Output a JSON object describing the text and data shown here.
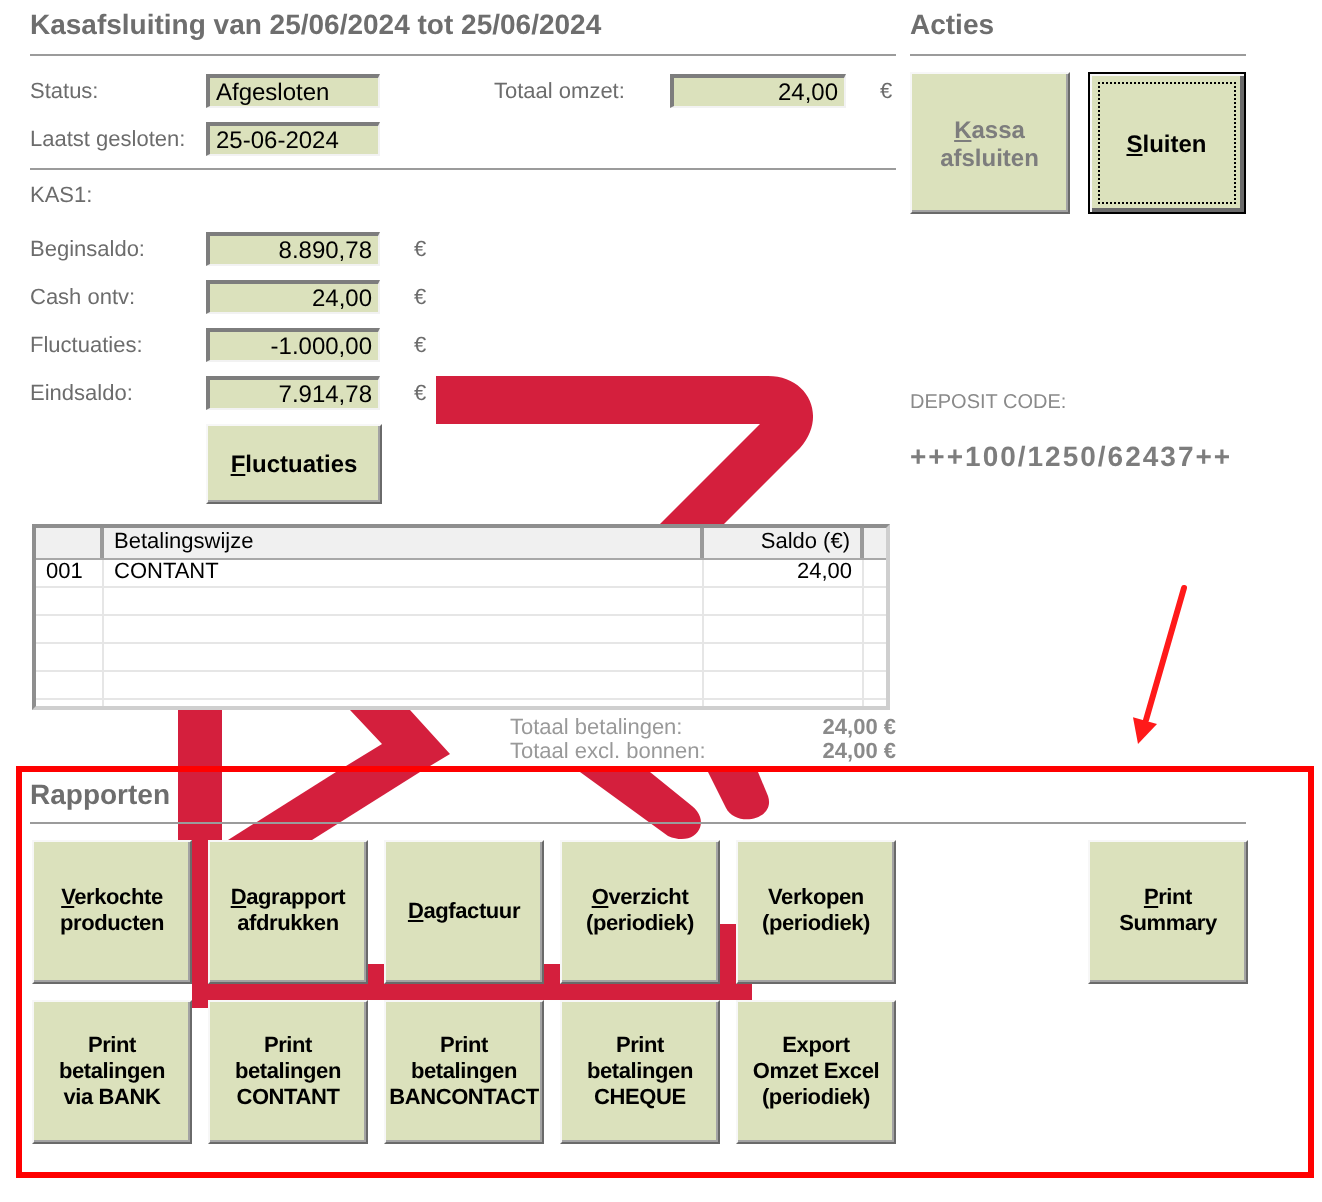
{
  "header": {
    "title": "Kasafsluiting van 25/06/2024 tot 25/06/2024"
  },
  "status": {
    "fields": [
      {
        "label": "Status:",
        "value": "Afgesloten"
      },
      {
        "label": "Laatst gesloten:",
        "value": "25-06-2024"
      }
    ],
    "turnover": {
      "label": "Totaal omzet:",
      "value": "24,00",
      "currency": "€"
    }
  },
  "register": {
    "title": "KAS1:",
    "fields": [
      {
        "label": "Beginsaldo:",
        "value": "8.890,78",
        "currency": "€"
      },
      {
        "label": "Cash ontv:",
        "value": "24,00",
        "currency": "€"
      },
      {
        "label": "Fluctuaties:",
        "value": "-1.000,00",
        "currency": "€"
      },
      {
        "label": "Eindsaldo:",
        "value": "7.914,78",
        "currency": "€"
      }
    ],
    "button": {
      "label": "Fluctuaties",
      "shortcut_underlined": true
    }
  },
  "table": {
    "columns": [
      {
        "label": "Betalingswijze"
      },
      {
        "label": "Saldo (€)"
      }
    ],
    "rows": [
      {
        "number": "001",
        "cells": [
          "CONTANT",
          "24,00"
        ]
      }
    ]
  },
  "totals": [
    {
      "label": "Totaal betalingen:",
      "value": "24,00 €"
    },
    {
      "label": "Totaal excl. bonnen:",
      "value": "24,00 €"
    }
  ],
  "actions": {
    "title": "Acties",
    "buttons": [
      {
        "label": "Kassa\nafsluiten",
        "shortcut_underlined": true,
        "disabled": true,
        "focused": false
      },
      {
        "label": "Sluiten",
        "shortcut_underlined": true,
        "disabled": false,
        "focused": true
      }
    ]
  },
  "deposit": {
    "label": "DEPOSIT CODE:",
    "code": "+++100/1250/62437++"
  },
  "reports": {
    "title": "Rapporten",
    "buttons": [
      {
        "label": "Verkochte\nproducten",
        "shortcut_underlined": true
      },
      {
        "label": "Dagrapport\nafdrukken",
        "shortcut_underlined": true
      },
      {
        "label": "Dagfactuur",
        "shortcut_underlined": true
      },
      {
        "label": "Overzicht\n(periodiek)",
        "shortcut_underlined": true
      },
      {
        "label": "Verkopen\n(periodiek)",
        "shortcut_underlined": false
      },
      {
        "label": "Print\nbetalingen\nvia BANK",
        "shortcut_underlined": false
      },
      {
        "label": "Print\nbetalingen\nCONTANT",
        "shortcut_underlined": false
      },
      {
        "label": "Print\nbetalingen\nBANCONTACT",
        "shortcut_underlined": false
      },
      {
        "label": "Print\nbetalingen\nCHEQUE",
        "shortcut_underlined": false
      },
      {
        "label": "Export\nOmzet Excel\n(periodiek)",
        "shortcut_underlined": false
      }
    ],
    "side_buttons": [
      {
        "label": "Print\nSummary",
        "shortcut_underlined": true
      }
    ]
  }
}
